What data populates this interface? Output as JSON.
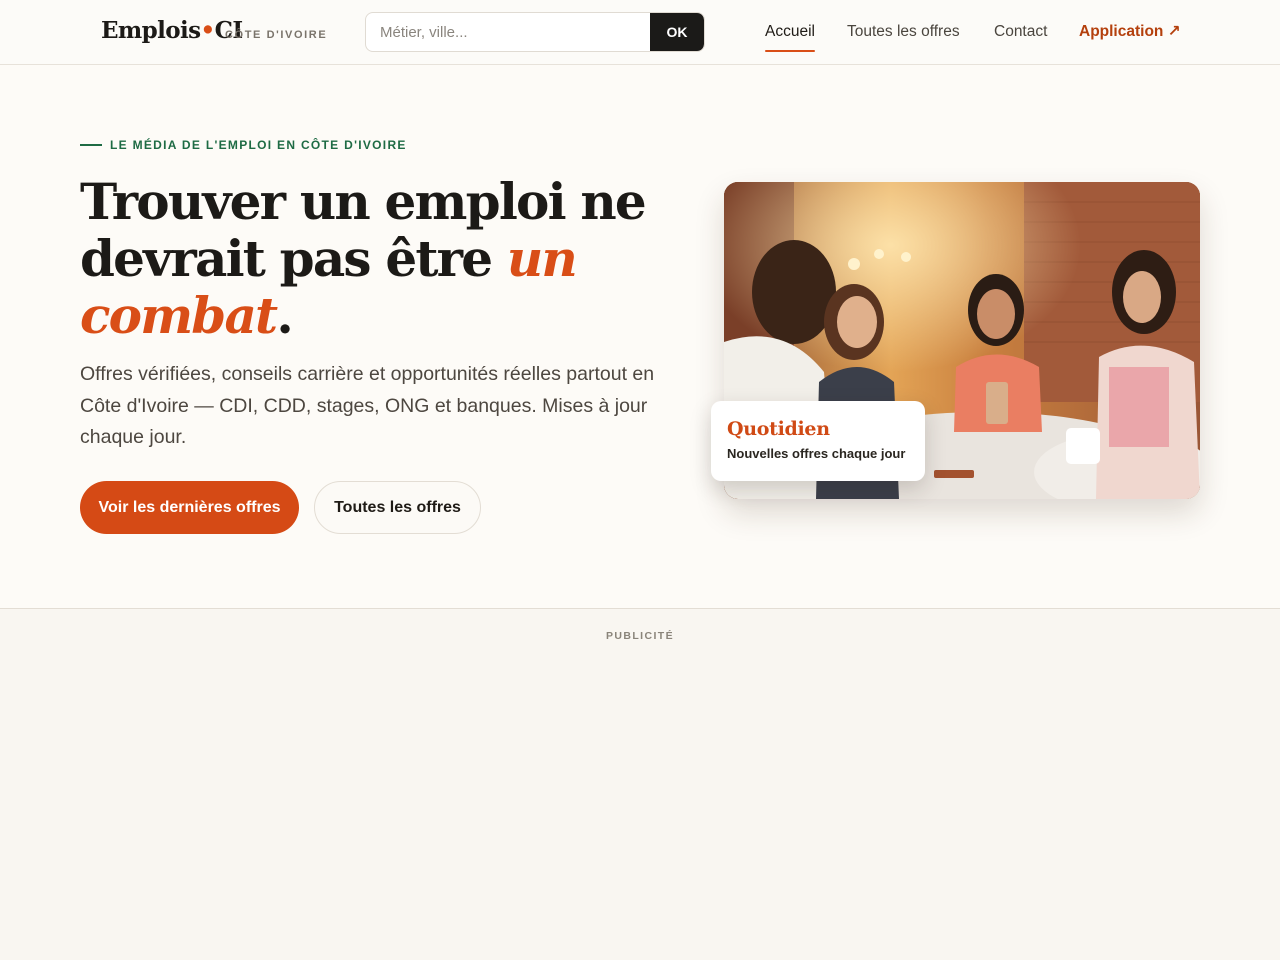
{
  "header": {
    "logo_main": "Emplois",
    "logo_dot": "•",
    "logo_suffix": "CI",
    "logo_sub": "CÔTE D'IVOIRE",
    "search_placeholder": "Métier, ville...",
    "search_value": "",
    "search_button": "OK",
    "nav": [
      {
        "label": "Accueil",
        "active": true
      },
      {
        "label": "Toutes les offres",
        "active": false
      },
      {
        "label": "Contact",
        "active": false
      },
      {
        "label": "Application ↗",
        "active": false
      }
    ]
  },
  "hero": {
    "eyebrow": "LE MÉDIA DE L'EMPLOI EN CÔTE D'IVOIRE",
    "headline_part1": "Trouver un emploi ne devrait pas être ",
    "headline_emph": "un combat",
    "headline_end": ".",
    "lead": "Offres vérifiées, conseils carrière et opportunités réelles partout en Côte d'Ivoire — CDI, CDD, stages, ONG et banques. Mises à jour chaque jour.",
    "primary_button": "Voir les dernières offres",
    "secondary_button": "Toutes les offres",
    "badge_title": "Quotidien",
    "badge_sub": "Nouvelles offres chaque jour"
  },
  "ad": {
    "label": "PUBLICITÉ"
  },
  "colors": {
    "accent": "#d94e17",
    "eyebrow": "#1e6b44",
    "dark": "#1b1a18"
  }
}
